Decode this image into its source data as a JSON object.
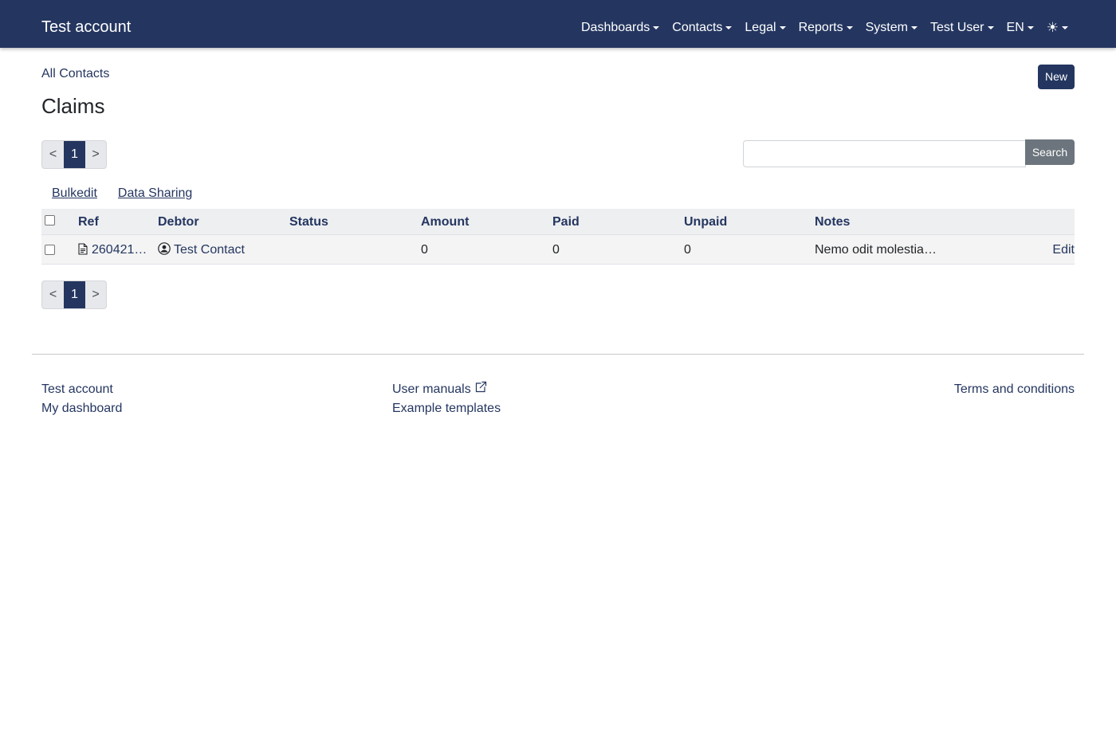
{
  "navbar": {
    "brand": "Test account",
    "items": [
      {
        "label": "Dashboards"
      },
      {
        "label": "Contacts"
      },
      {
        "label": "Legal"
      },
      {
        "label": "Reports"
      },
      {
        "label": "System"
      },
      {
        "label": "Test User"
      },
      {
        "label": "EN"
      }
    ],
    "theme_icon": "sun-icon",
    "theme_glyph": "☀"
  },
  "header": {
    "breadcrumb": "All Contacts",
    "title": "Claims",
    "new_button": "New"
  },
  "pagination": {
    "prev": "<",
    "current": "1",
    "next": ">"
  },
  "search": {
    "value": "",
    "placeholder": "",
    "button": "Search"
  },
  "actions": {
    "bulkedit": "Bulkedit",
    "data_sharing": "Data Sharing"
  },
  "table": {
    "columns": [
      "Ref",
      "Debtor",
      "Status",
      "Amount",
      "Paid",
      "Unpaid",
      "Notes"
    ],
    "rows": [
      {
        "ref": "260421…",
        "debtor": "Test Contact",
        "status": "",
        "amount": "0",
        "paid": "0",
        "unpaid": "0",
        "notes": "Nemo odit molestia…",
        "edit": "Edit"
      }
    ]
  },
  "footer": {
    "col1": [
      "Test account",
      "My dashboard"
    ],
    "col2": [
      "User manuals",
      "Example templates"
    ],
    "col3": [
      "Terms and conditions"
    ]
  },
  "colors": {
    "primary": "#243660",
    "secondary_button": "#6c757d",
    "table_header_bg": "#eeeff1",
    "row_bg": "#f4f4f4"
  }
}
